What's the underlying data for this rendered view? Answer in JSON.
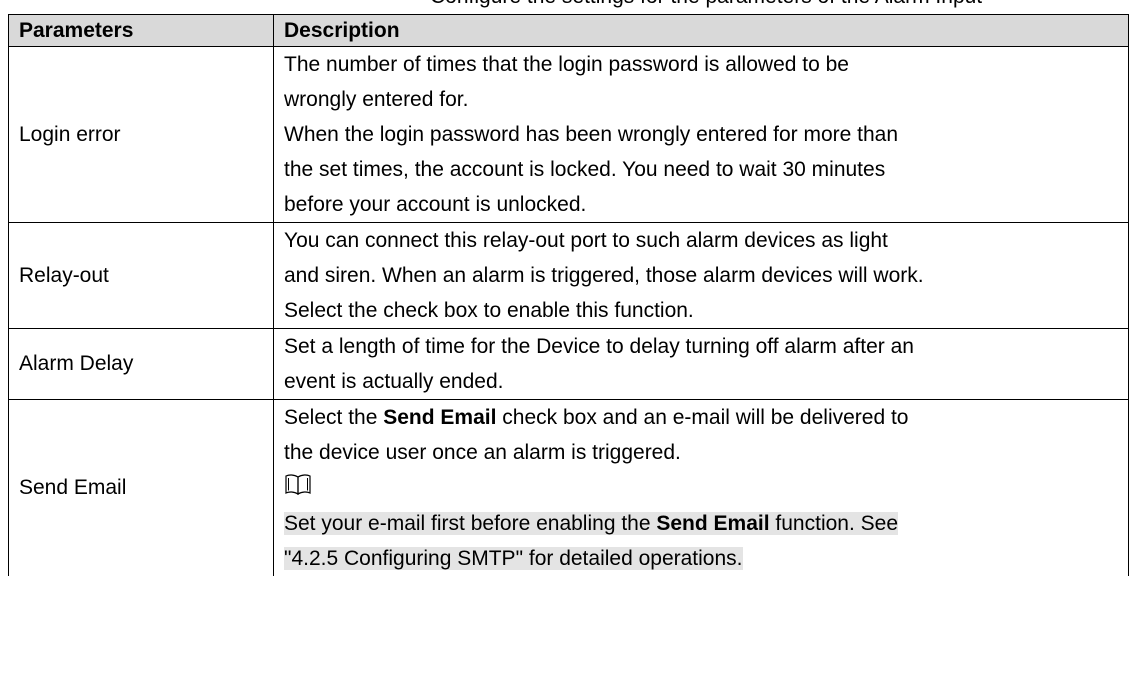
{
  "caption_fragment": "Configure the settings for the parameters of the Alarm Input",
  "table": {
    "headers": [
      "Parameters",
      "Description"
    ],
    "rows": [
      {
        "param": "Login error",
        "lines": [
          "The number of times that the login password is allowed to be",
          "wrongly entered for.",
          "When the login password has been wrongly entered for more than",
          "the set times, the account is locked. You need to wait 30 minutes",
          "before your account is unlocked."
        ]
      },
      {
        "param": "Relay-out",
        "lines": [
          "You can connect this relay-out port to such alarm devices as light",
          "and siren. When an alarm is triggered, those alarm devices will work.",
          "Select the check box to enable this function."
        ]
      },
      {
        "param": "Alarm Delay",
        "lines": [
          "Set a length of time for the Device to delay turning off alarm after an",
          "event is actually ended."
        ]
      },
      {
        "param": "Send Email",
        "line1": {
          "pre": "Select the ",
          "bold": "Send Email",
          "post": " check box and an e-mail will be delivered to"
        },
        "line2": "the device user once an alarm is triggered.",
        "note_icon": "book-note-icon",
        "note_line1": {
          "pre": "Set your e-mail first before enabling the ",
          "bold": "Send Email",
          "post": " function. See"
        },
        "note_line2": "\"4.2.5 Configuring SMTP\" for detailed operations."
      }
    ]
  }
}
